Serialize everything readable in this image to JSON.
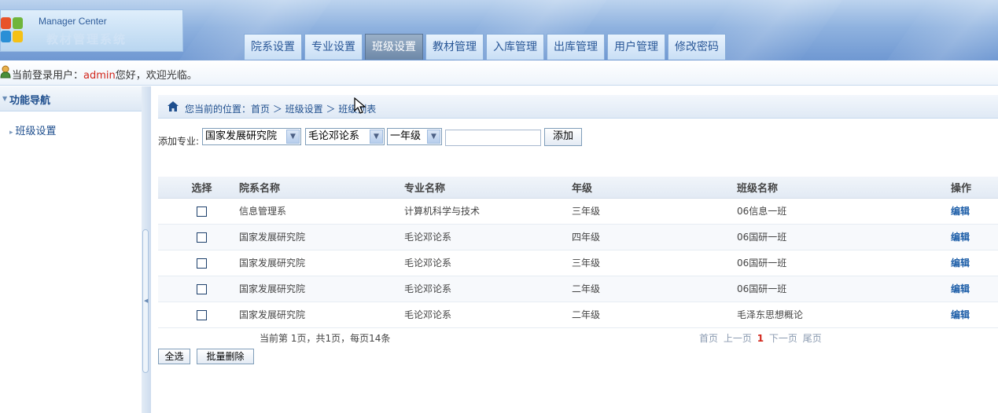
{
  "header": {
    "brand_en": "Manager Center",
    "brand_cn": "教材管理系统",
    "tabs": [
      {
        "label": "院系设置",
        "active": false
      },
      {
        "label": "专业设置",
        "active": false
      },
      {
        "label": "班级设置",
        "active": true
      },
      {
        "label": "教材管理",
        "active": false
      },
      {
        "label": "入库管理",
        "active": false
      },
      {
        "label": "出库管理",
        "active": false
      },
      {
        "label": "用户管理",
        "active": false
      },
      {
        "label": "修改密码",
        "active": false
      }
    ]
  },
  "userbar": {
    "icon": "user-icon",
    "prefix": "当前登录用户：",
    "username": "admin",
    "suffix": "您好，欢迎光临。"
  },
  "sidebar": {
    "title": "功能导航",
    "items": [
      {
        "label": "班级设置"
      }
    ]
  },
  "breadcrumb": {
    "icon": "home-icon",
    "text": "您当前的位置：首页 ＞ 班级设置 ＞ 班级列表"
  },
  "add_form": {
    "label": "添加专业:",
    "department_select": "国家发展研究院",
    "major_select": "毛论邓论系",
    "grade_select": "一年级",
    "class_name_value": "",
    "add_button": "添加"
  },
  "table": {
    "headers": [
      "选择",
      "院系名称",
      "专业名称",
      "年级",
      "班级名称",
      "操作"
    ],
    "rows": [
      {
        "department": "信息管理系",
        "major": "计算机科学与技术",
        "grade": "三年级",
        "class": "06信息一班",
        "action": "编辑"
      },
      {
        "department": "国家发展研究院",
        "major": "毛论邓论系",
        "grade": "四年级",
        "class": "06国研一班",
        "action": "编辑"
      },
      {
        "department": "国家发展研究院",
        "major": "毛论邓论系",
        "grade": "三年级",
        "class": "06国研一班",
        "action": "编辑"
      },
      {
        "department": "国家发展研究院",
        "major": "毛论邓论系",
        "grade": "二年级",
        "class": "06国研一班",
        "action": "编辑"
      },
      {
        "department": "国家发展研究院",
        "major": "毛论邓论系",
        "grade": "二年级",
        "class": "毛泽东思想概论",
        "action": "编辑"
      }
    ]
  },
  "pager": {
    "info": "当前第  1页，共1页，每页14条",
    "first": "首页",
    "prev": "上一页",
    "current": "1",
    "next": "下一页",
    "last": "尾页"
  },
  "actions": {
    "select_all": "全选",
    "batch_delete": "批量删除"
  },
  "colors": {
    "accent": "#1f4f8e",
    "username": "#d2261b",
    "header": "#8fb2df"
  }
}
